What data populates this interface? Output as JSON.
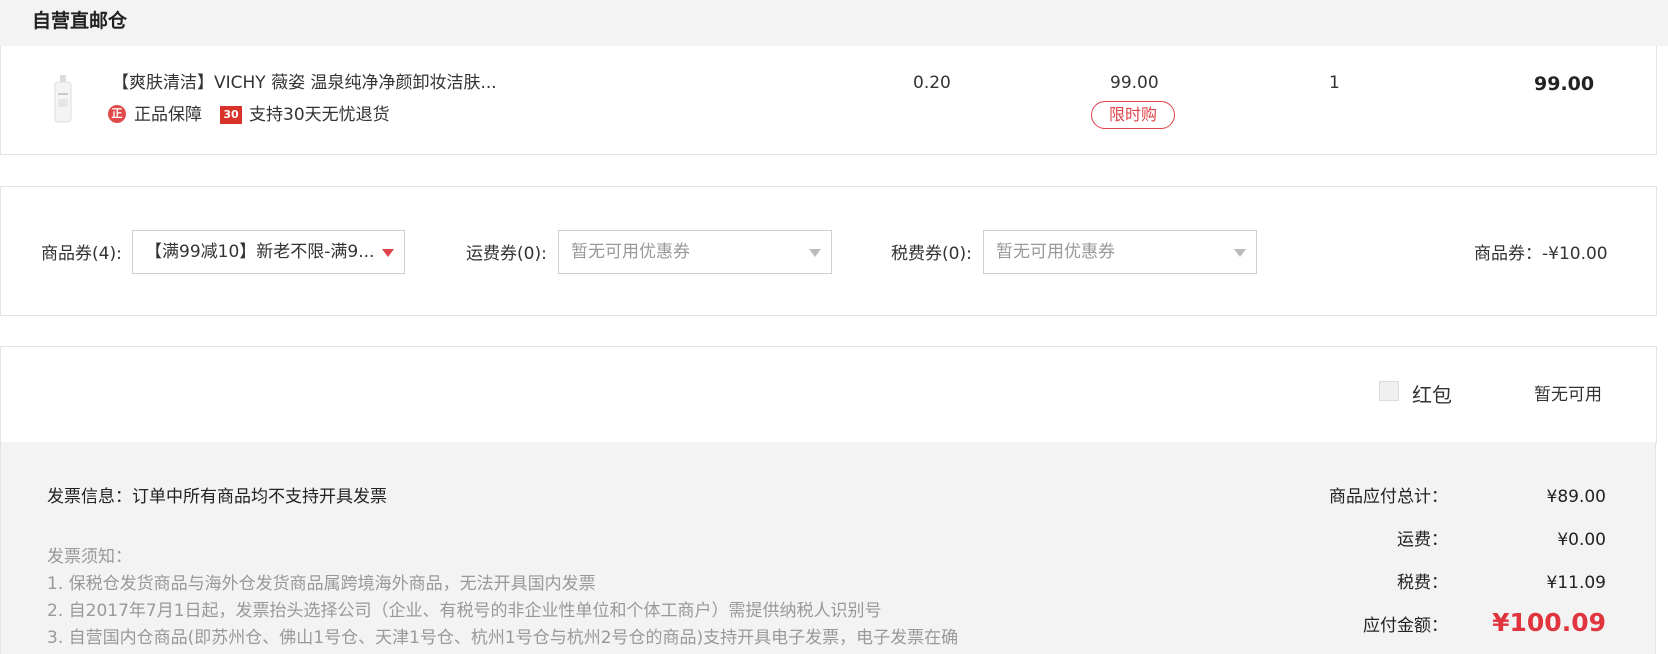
{
  "warehouse": {
    "title": "自营直邮仓"
  },
  "product": {
    "name": "【爽肤清洁】VICHY 薇姿 温泉纯净净颜卸妆洁肤...",
    "tag_authentic": "正品保障",
    "tag_authentic_icon": "正",
    "tag_return": "支持30天无忧退货",
    "tag_return_icon": "30",
    "tax": "0.20",
    "price": "99.00",
    "limit_badge": "限时购",
    "quantity": "1",
    "subtotal": "99.00"
  },
  "coupons": {
    "goods_label": "商品券(4):",
    "goods_selected": "【满99减10】新老不限-满9...",
    "shipping_label": "运费券(0):",
    "shipping_placeholder": "暂无可用优惠券",
    "tax_label": "税费券(0):",
    "tax_placeholder": "暂无可用优惠券",
    "summary": "商品券：-¥10.00"
  },
  "red_packet": {
    "label": "红包",
    "status": "暂无可用",
    "checked": false
  },
  "invoice": {
    "info": "发票信息：订单中所有商品均不支持开具发票",
    "notice_title": "发票须知：",
    "notices": [
      "1. 保税仓发货商品与海外仓发货商品属跨境海外商品，无法开具国内发票",
      "2. 自2017年7月1日起，发票抬头选择公司（企业、有税号的非企业性单位和个体工商户）需提供纳税人识别号",
      "3. 自营国内仓商品(即苏州仓、佛山1号仓、天津1号仓、杭州1号仓与杭州2号仓的商品)支持开具电子发票，电子发票在确"
    ]
  },
  "totals": {
    "goods_label": "商品应付总计：",
    "goods_value": "¥89.00",
    "shipping_label": "运费：",
    "shipping_value": "¥0.00",
    "tax_label": "税费：",
    "tax_value": "¥11.09",
    "payable_label": "应付金额：",
    "payable_value": "¥100.09"
  },
  "colors": {
    "accent_red": "#e0343f",
    "panel_gray": "#f3f3f3",
    "border": "#e4e4e4"
  }
}
